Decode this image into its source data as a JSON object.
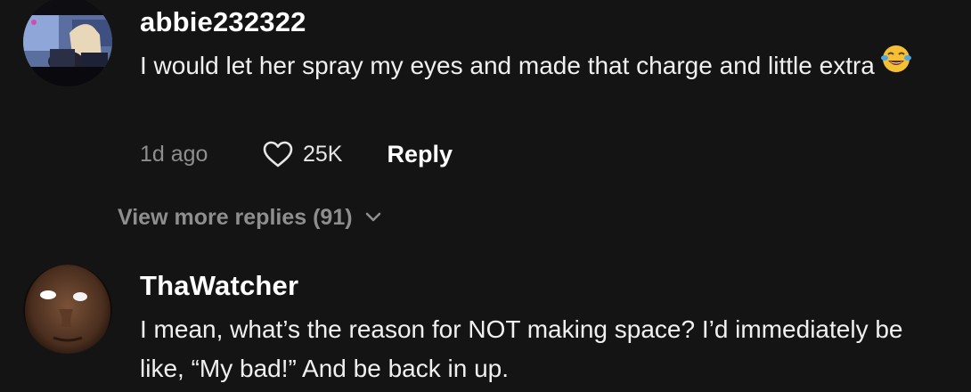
{
  "comments": [
    {
      "username": "abbie232322",
      "text": "I would let her spray my eyes and made that charge and little extra",
      "emoji": "tears-of-joy-emoji",
      "time": "1d ago",
      "likes": "25K",
      "reply_label": "Reply",
      "view_more": "View more replies (91)"
    },
    {
      "username": "ThaWatcher",
      "text": "I mean, what’s the reason for NOT making space? I’d immediately be like, “My bad!” And be back in up."
    }
  ],
  "colors": {
    "background": "#141414",
    "primary_text": "#f0f0f0",
    "secondary_text": "#8e8e8e"
  },
  "icons": [
    "heart-outline-icon",
    "chevron-down-icon"
  ]
}
